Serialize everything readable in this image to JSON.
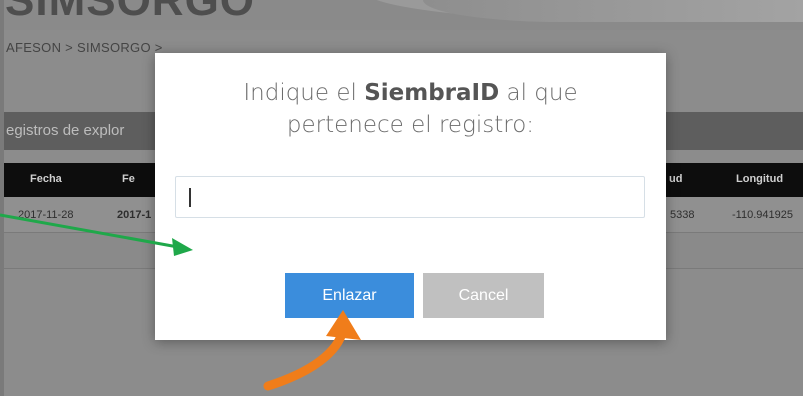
{
  "page": {
    "banner_title": "SIMSORGO",
    "breadcrumb": "AFESON  >  SIMSORGO  >",
    "section_title": "egistros de explor"
  },
  "table": {
    "headers": [
      "Fecha",
      "Fe",
      "ud",
      "Longitud"
    ],
    "row": [
      "2017-11-28",
      "2017-1",
      "5338",
      "-110.941925"
    ]
  },
  "modal": {
    "title_prefix": "Indique el ",
    "title_bold": "SiembraID",
    "title_suffix": " al que",
    "title_line2": "pertenece el registro:",
    "input_value": "",
    "confirm_label": "Enlazar",
    "cancel_label": "Cancel"
  },
  "colors": {
    "confirm_button": "#3b8ddc",
    "cancel_button": "#c0c0c0",
    "overlay": "#8c8c8c",
    "green_arrow": "#1fa84a",
    "orange_arrow": "#f07d1a"
  }
}
